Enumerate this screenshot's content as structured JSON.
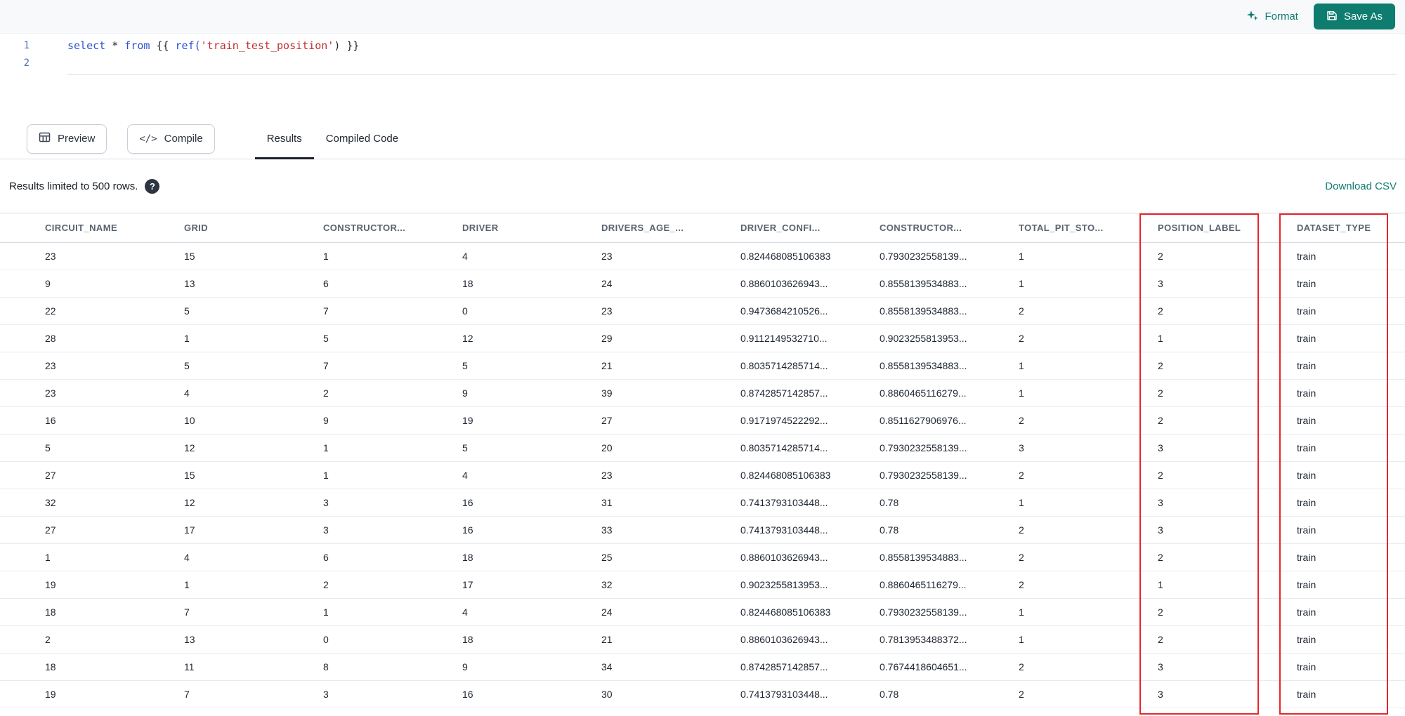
{
  "topbar": {
    "format_label": "Format",
    "save_as_label": "Save As"
  },
  "editor": {
    "line_numbers": [
      "1",
      "2"
    ],
    "tokens": [
      {
        "text": "select ",
        "type": "keyword"
      },
      {
        "text": "* ",
        "type": "plain"
      },
      {
        "text": "from ",
        "type": "keyword"
      },
      {
        "text": "{{ ",
        "type": "plain"
      },
      {
        "text": "ref(",
        "type": "function"
      },
      {
        "text": "'train_test_position'",
        "type": "string"
      },
      {
        "text": ") }}",
        "type": "plain"
      }
    ]
  },
  "toolbar": {
    "preview_label": "Preview",
    "compile_label": "Compile",
    "compile_icon": "</>",
    "tabs": [
      {
        "label": "Results",
        "active": true
      },
      {
        "label": "Compiled Code",
        "active": false
      }
    ]
  },
  "results_bar": {
    "limit_text": "Results limited to 500 rows.",
    "help_icon": "?",
    "download_label": "Download CSV"
  },
  "table": {
    "columns": [
      "CIRCUIT_NAME",
      "GRID",
      "CONSTRUCTOR...",
      "DRIVER",
      "DRIVERS_AGE_...",
      "DRIVER_CONFI...",
      "CONSTRUCTOR...",
      "TOTAL_PIT_STO...",
      "POSITION_LABEL",
      "DATASET_TYPE"
    ],
    "highlighted_columns": [
      "POSITION_LABEL",
      "DATASET_TYPE"
    ],
    "highlight_color": "#e8262b",
    "rows": [
      [
        "23",
        "15",
        "1",
        "4",
        "23",
        "0.824468085106383",
        "0.7930232558139...",
        "1",
        "2",
        "train"
      ],
      [
        "9",
        "13",
        "6",
        "18",
        "24",
        "0.8860103626943...",
        "0.8558139534883...",
        "1",
        "3",
        "train"
      ],
      [
        "22",
        "5",
        "7",
        "0",
        "23",
        "0.9473684210526...",
        "0.8558139534883...",
        "2",
        "2",
        "train"
      ],
      [
        "28",
        "1",
        "5",
        "12",
        "29",
        "0.9112149532710...",
        "0.9023255813953...",
        "2",
        "1",
        "train"
      ],
      [
        "23",
        "5",
        "7",
        "5",
        "21",
        "0.8035714285714...",
        "0.8558139534883...",
        "1",
        "2",
        "train"
      ],
      [
        "23",
        "4",
        "2",
        "9",
        "39",
        "0.8742857142857...",
        "0.8860465116279...",
        "1",
        "2",
        "train"
      ],
      [
        "16",
        "10",
        "9",
        "19",
        "27",
        "0.9171974522292...",
        "0.8511627906976...",
        "2",
        "2",
        "train"
      ],
      [
        "5",
        "12",
        "1",
        "5",
        "20",
        "0.8035714285714...",
        "0.7930232558139...",
        "3",
        "3",
        "train"
      ],
      [
        "27",
        "15",
        "1",
        "4",
        "23",
        "0.824468085106383",
        "0.7930232558139...",
        "2",
        "2",
        "train"
      ],
      [
        "32",
        "12",
        "3",
        "16",
        "31",
        "0.7413793103448...",
        "0.78",
        "1",
        "3",
        "train"
      ],
      [
        "27",
        "17",
        "3",
        "16",
        "33",
        "0.7413793103448...",
        "0.78",
        "2",
        "3",
        "train"
      ],
      [
        "1",
        "4",
        "6",
        "18",
        "25",
        "0.8860103626943...",
        "0.8558139534883...",
        "2",
        "2",
        "train"
      ],
      [
        "19",
        "1",
        "2",
        "17",
        "32",
        "0.9023255813953...",
        "0.8860465116279...",
        "2",
        "1",
        "train"
      ],
      [
        "18",
        "7",
        "1",
        "4",
        "24",
        "0.824468085106383",
        "0.7930232558139...",
        "1",
        "2",
        "train"
      ],
      [
        "2",
        "13",
        "0",
        "18",
        "21",
        "0.8860103626943...",
        "0.7813953488372...",
        "1",
        "2",
        "train"
      ],
      [
        "18",
        "11",
        "8",
        "9",
        "34",
        "0.8742857142857...",
        "0.7674418604651...",
        "2",
        "3",
        "train"
      ],
      [
        "19",
        "7",
        "3",
        "16",
        "30",
        "0.7413793103448...",
        "0.78",
        "2",
        "3",
        "train"
      ]
    ]
  },
  "colors": {
    "accent_teal": "#0e7c6f",
    "highlight_red": "#e8262b"
  }
}
